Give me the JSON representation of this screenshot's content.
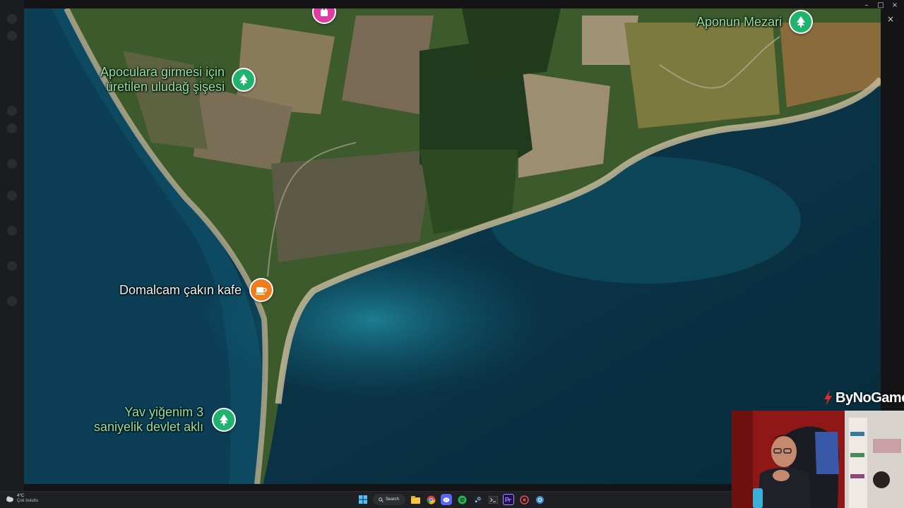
{
  "window": {
    "minimize": "–",
    "maximize": "□",
    "close": "×",
    "map_close": "×"
  },
  "map": {
    "markers": [
      {
        "id": "aponun",
        "label": "Aponun Mezari",
        "icon": "tree-icon",
        "color": "#1fb36d"
      },
      {
        "id": "uludag",
        "label": "Apoculara girmesi için\nüretilen uludağ şişesi",
        "icon": "tree-icon",
        "color": "#1fb36d"
      },
      {
        "id": "kafe",
        "label": "Domalcam çakın kafe",
        "icon": "coffee-cup-icon",
        "color": "#f07c1b"
      },
      {
        "id": "yav",
        "label": "Yav yiğenim 3\nsaniyelik devlet aklı",
        "icon": "tree-icon",
        "color": "#1fb36d"
      },
      {
        "id": "shop",
        "label": "",
        "icon": "shopping-bag-icon",
        "color": "#e33ca0"
      }
    ]
  },
  "watermark": {
    "text": "ByNoGame"
  },
  "taskbar": {
    "weather_temp": "4°C",
    "weather_condition": "Çok bulutlu",
    "search_label": "Search",
    "apps": [
      "windows-start-icon",
      "file-explorer-icon",
      "chrome-icon",
      "discord-icon",
      "spotify-icon",
      "steam-icon",
      "terminal-icon",
      "premiere-icon",
      "app-icon",
      "settings-icon"
    ]
  }
}
